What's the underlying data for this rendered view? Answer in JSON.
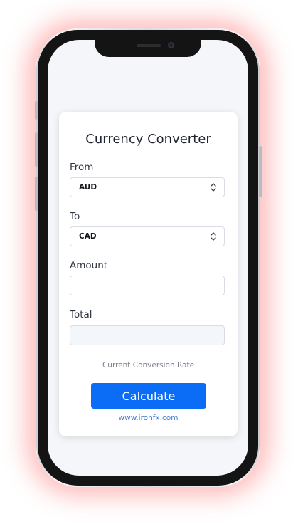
{
  "card": {
    "title": "Currency Converter",
    "from": {
      "label": "From",
      "value": "AUD"
    },
    "to": {
      "label": "To",
      "value": "CAD"
    },
    "amount": {
      "label": "Amount",
      "value": "",
      "placeholder": ""
    },
    "total": {
      "label": "Total",
      "value": ""
    },
    "rate_text": "Current Conversion Rate",
    "calculate_label": "Calculate",
    "link_text": "www.ironfx.com"
  },
  "colors": {
    "primary_button": "#0b6cf5",
    "link": "#3b79cf",
    "glow": "#ff4646"
  },
  "icons": [
    "updown-chevron-icon",
    "camera-icon",
    "speaker-grille"
  ]
}
